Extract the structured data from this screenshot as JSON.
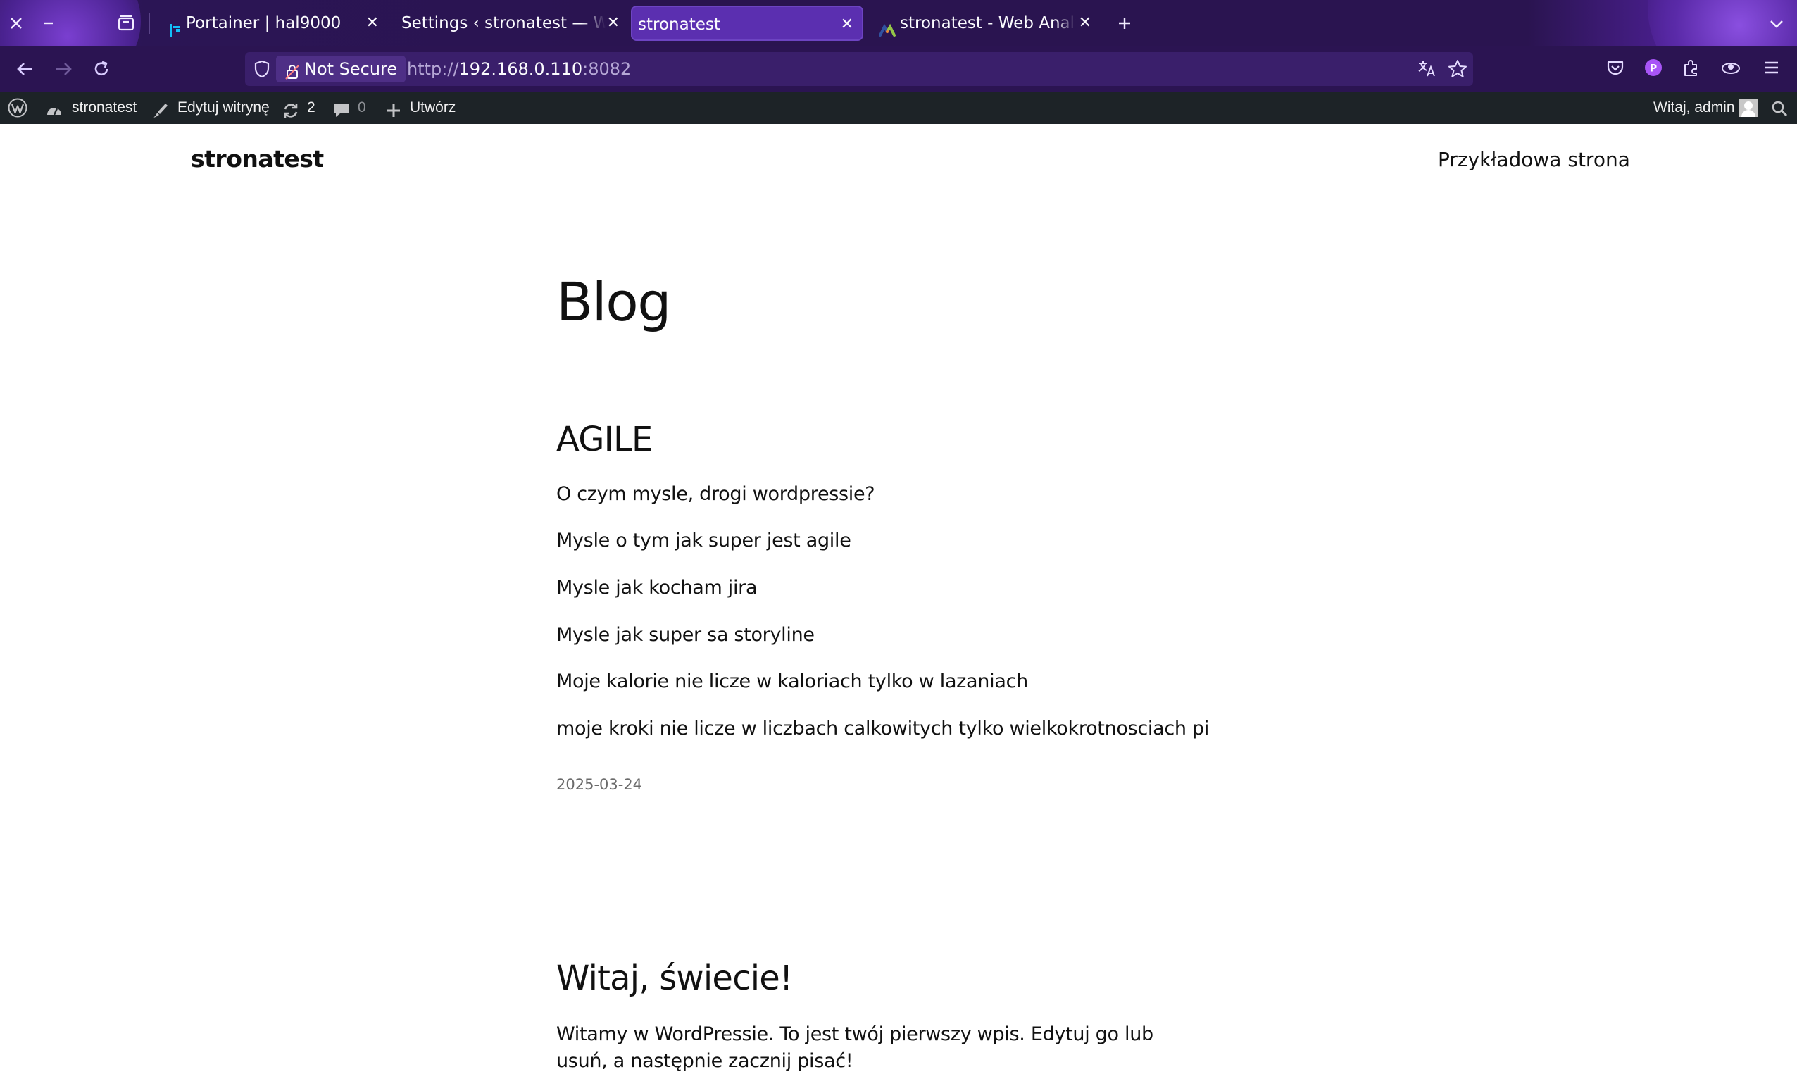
{
  "browser": {
    "tabs": [
      {
        "title": "Portainer | hal9000",
        "active": false
      },
      {
        "title": "Settings ‹ stronatest — WordPress",
        "active": false
      },
      {
        "title": "stronatest",
        "active": true
      },
      {
        "title": "stronatest - Web Analytics",
        "active": false
      }
    ],
    "url": {
      "security_label": "Not Secure",
      "scheme": "http://",
      "host": "192.168.0.110",
      "port": ":8082"
    }
  },
  "adminbar": {
    "site_name": "stronatest",
    "edit_site": "Edytuj witrynę",
    "updates_count": "2",
    "comments_count": "0",
    "new_label": "Utwórz",
    "greeting": "Witaj, admin"
  },
  "site": {
    "title": "stronatest",
    "nav_item": "Przykładowa strona"
  },
  "main": {
    "heading": "Blog",
    "posts": [
      {
        "title": "AGILE",
        "lines": [
          "O czym mysle, drogi wordpressie?",
          "Mysle o tym jak super jest agile",
          "Mysle jak kocham jira",
          "Mysle jak super sa storyline",
          "Moje kalorie nie licze w kaloriach tylko w lazaniach",
          "moje kroki nie licze w liczbach calkowitych tylko wielkokrotnosciach pi"
        ],
        "date": "2025-03-24"
      },
      {
        "title": "Witaj, świecie!",
        "excerpt": "Witamy w WordPressie. To jest twój pierwszy wpis. Edytuj go lub usuń, a następnie zacznij pisać!"
      }
    ]
  },
  "colors": {
    "tabstrip": "#2a1450",
    "navbar": "#2b1452",
    "active_tab": "#5b2fb0",
    "adminbar": "#1d2327",
    "profile_badge": "#a855f7"
  }
}
